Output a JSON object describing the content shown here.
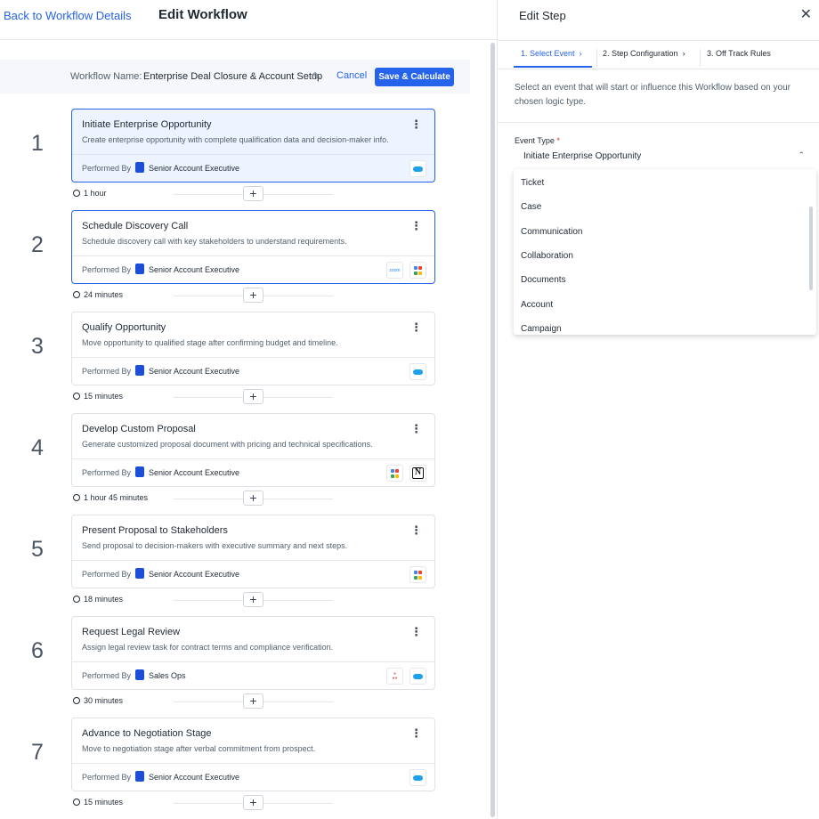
{
  "header": {
    "back_label": "Back to Workflow Details",
    "title": "Edit Workflow"
  },
  "workflow": {
    "name_label": "Workflow Name:",
    "name": "Enterprise Deal Closure & Account Setup",
    "cancel_label": "Cancel",
    "save_label": "Save & Calculate"
  },
  "steps": [
    {
      "num": "1",
      "title": "Initiate Enterprise Opportunity",
      "desc": "Create enterprise opportunity with complete qualification data and decision-maker info.",
      "performed_label": "Performed By",
      "role": "Senior Account Executive",
      "duration": "1 hour",
      "apps": [
        "salesforce"
      ]
    },
    {
      "num": "2",
      "title": "Schedule Discovery Call",
      "desc": "Schedule discovery call with key stakeholders to understand requirements.",
      "performed_label": "Performed By",
      "role": "Senior Account Executive",
      "duration": "24 minutes",
      "apps": [
        "zoom",
        "gsuite"
      ]
    },
    {
      "num": "3",
      "title": "Qualify Opportunity",
      "desc": "Move opportunity to qualified stage after confirming budget and timeline.",
      "performed_label": "Performed By",
      "role": "Senior Account Executive",
      "duration": "15 minutes",
      "apps": [
        "salesforce"
      ]
    },
    {
      "num": "4",
      "title": "Develop Custom Proposal",
      "desc": "Generate customized proposal document with pricing and technical specifications.",
      "performed_label": "Performed By",
      "role": "Senior Account Executive",
      "duration": "1 hour 45 minutes",
      "apps": [
        "gsuite",
        "notion"
      ]
    },
    {
      "num": "5",
      "title": "Present Proposal to Stakeholders",
      "desc": "Send proposal to decision-makers with executive summary and next steps.",
      "performed_label": "Performed By",
      "role": "Senior Account Executive",
      "duration": "18 minutes",
      "apps": [
        "gsuite"
      ]
    },
    {
      "num": "6",
      "title": "Request Legal Review",
      "desc": "Assign legal review task for contract terms and compliance verification.",
      "performed_label": "Performed By",
      "role": "Sales Ops",
      "duration": "30 minutes",
      "apps": [
        "asana",
        "salesforce"
      ]
    },
    {
      "num": "7",
      "title": "Advance to Negotiation Stage",
      "desc": "Move to negotiation stage after verbal commitment from prospect.",
      "performed_label": "Performed By",
      "role": "Senior Account Executive",
      "duration": "15 minutes",
      "apps": [
        "salesforce"
      ]
    }
  ],
  "panel": {
    "title": "Edit Step",
    "close_glyph": "✕",
    "tabs": [
      "1. Select Event",
      "2. Step Configuration",
      "3. Off Track Rules"
    ],
    "help": "Select an event that will start or influence this Workflow based on your chosen logic type.",
    "field_label": "Event Type",
    "required_mark": "*",
    "selected_value": "Initiate Enterprise Opportunity",
    "options": [
      "Ticket",
      "Case",
      "Communication",
      "Collaboration",
      "Documents",
      "Account",
      "Campaign"
    ]
  },
  "colors": {
    "accent": "#2563eb",
    "salesforce": "#1ea1e8"
  }
}
